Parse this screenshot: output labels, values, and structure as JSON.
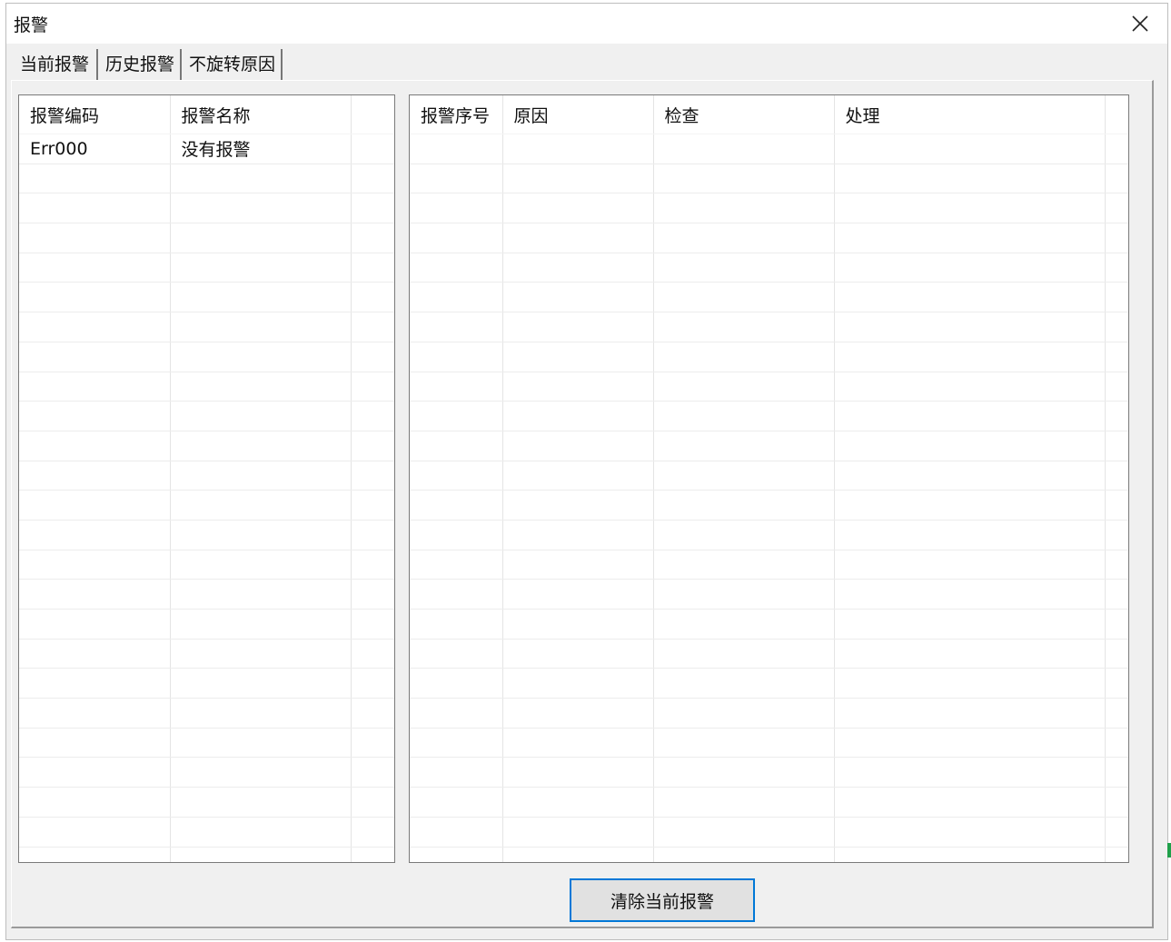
{
  "window": {
    "title": "报警"
  },
  "tabs": [
    {
      "label": "当前报警",
      "active": true
    },
    {
      "label": "历史报警",
      "active": false
    },
    {
      "label": "不旋转原因",
      "active": false
    }
  ],
  "left_list": {
    "columns": [
      "报警编码",
      "报警名称"
    ],
    "rows": [
      [
        "Err000",
        "没有报警"
      ]
    ]
  },
  "right_list": {
    "columns": [
      "报警序号",
      "原因",
      "检查",
      "处理"
    ],
    "rows": []
  },
  "buttons": {
    "clear_label": "清除当前报警"
  },
  "icons": {
    "close": "close-icon"
  },
  "colors": {
    "focus_border": "#0078d7",
    "window_bg": "#f0f0f0"
  }
}
